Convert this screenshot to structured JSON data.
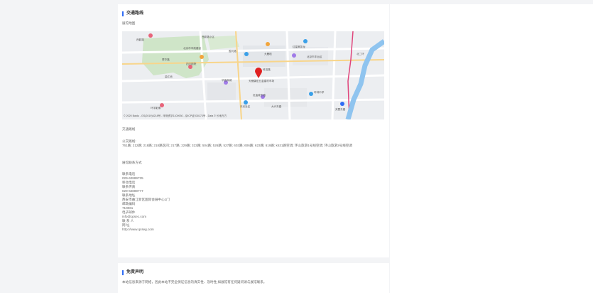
{
  "traffic": {
    "title": "交通路线",
    "map_label": "展馆地图",
    "route_heading": "交通路线",
    "bus_label": "公交路线:",
    "bus_routes": "761路; 212路; 218路; 218路区间; 217路; 229路; 323路; 504路; 526路; 527路; 603路; 606路; 623路; 619路; k631路空调; 环山旅游1号线空调; 环山旅游2号线空调",
    "contact_heading": "展馆联系方式"
  },
  "map": {
    "copyright": "© 2020 Baidu - GS(2019)5218号 - 甲测资字1100930 - 京ICP证030173号 - Data © 长地万方",
    "poi": [
      "西影路",
      "科技路",
      "华鑫商城",
      "天穗康宏五金建材市场",
      "红星美凯龙",
      "北京市市政建设",
      "北京市丰台区",
      "四方剧院",
      "胜利路",
      "翠华路",
      "曲江池",
      "红庙坡东路",
      "东光社区",
      "环林中学",
      "环宇影像",
      "大雁塔",
      "北二环",
      "芙蓉东路",
      "西影路小区",
      "大兴东路"
    ]
  },
  "contact": {
    "lines": [
      "联系电话",
      "029-62889735",
      "移动电话",
      "联系传真",
      "029-62889777",
      "联系地址",
      "西安市曲江新区国际会展中心1门",
      "邮政编码",
      "710061",
      "电子邮件",
      "info@qcsec.com",
      "联 系 人",
      "网 址",
      "http://www.qcseg.com"
    ]
  },
  "disclaimer": {
    "title": "免责声明",
    "text": "本站信息来源于网络，因此本站不完全保证信息的真实性、及时性,如展馆有任何疑问请与展馆联系。"
  },
  "colors": {
    "accent": "#2f6cf5",
    "background": "#f3f4f6",
    "river": "#8fc4ef",
    "park": "#cde5c6",
    "railway": "#e0457b",
    "marker": "#e02020"
  }
}
